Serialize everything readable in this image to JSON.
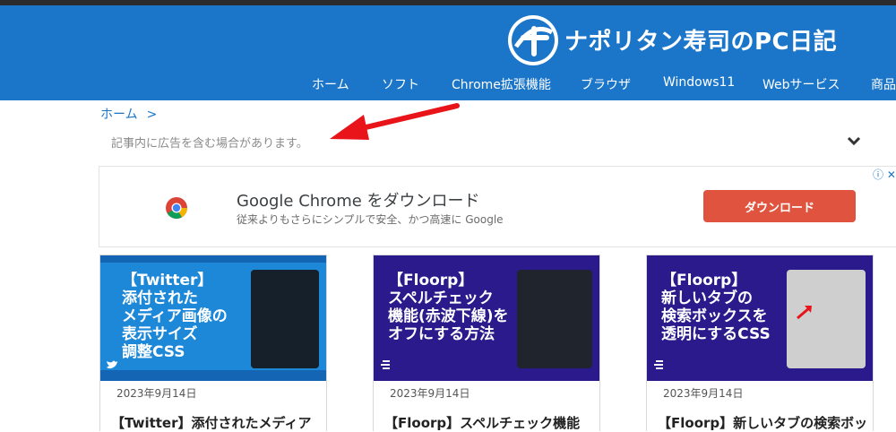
{
  "header": {
    "site_title": "ナポリタン寿司のPC日記",
    "nav": [
      "ホーム",
      "ソフト",
      "Chrome拡張機能",
      "ブラウザ",
      "Windows11",
      "Webサービス",
      "商品"
    ]
  },
  "breadcrumb": {
    "home": "ホーム",
    "separator": ">"
  },
  "disclaimer": "記事内に広告を含む場合があります。",
  "ad": {
    "title": "Google Chrome をダウンロード",
    "subtitle": "従来よりもさらにシンプルで安全、かつ高速に Google",
    "button": "ダウンロード",
    "info": "ⓘ ✕"
  },
  "cards": [
    {
      "thumb_text": "【Twitter】\n添付された\nメディア画像の\n表示サイズ\n調整CSS",
      "date": "2023年9月14日",
      "title": "【Twitter】添付されたメディア"
    },
    {
      "thumb_text": "【Floorp】\nスペルチェック\n機能(赤波下線)を\nオフにする方法",
      "date": "2023年9月14日",
      "title": "【Floorp】スペルチェック機能"
    },
    {
      "thumb_text": "【Floorp】\n新しいタブの\n検索ボックスを\n透明にするCSS",
      "date": "2023年9月14日",
      "title": "【Floorp】新しいタブの検索ボッ"
    }
  ],
  "colors": {
    "header": "#1b76c9",
    "card1": "#1e88d8",
    "card2": "#2a1a8c",
    "card3": "#2a1a8c",
    "ad_button": "#e0543f",
    "arrow": "#e8141a"
  }
}
